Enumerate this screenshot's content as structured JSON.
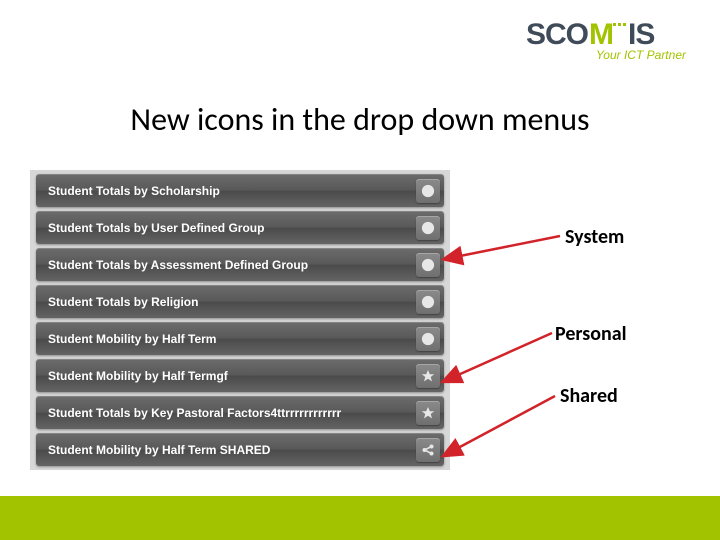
{
  "logo": {
    "word_prefix": "SCO",
    "word_accent": "M",
    "word_suffix": "IS",
    "tagline": "Your ICT Partner"
  },
  "title": "New icons in the drop down menus",
  "menu": [
    {
      "label": "Student Totals by Scholarship",
      "icon": "circle"
    },
    {
      "label": "Student Totals by User Defined Group",
      "icon": "circle"
    },
    {
      "label": "Student Totals by Assessment Defined Group",
      "icon": "circle"
    },
    {
      "label": "Student Totals by Religion",
      "icon": "circle"
    },
    {
      "label": "Student Mobility by Half Term",
      "icon": "circle"
    },
    {
      "label": "Student Mobility by Half Termgf",
      "icon": "star"
    },
    {
      "label": "Student Totals by Key Pastoral Factors4ttrrrrrrrrrrrr",
      "icon": "star"
    },
    {
      "label": "Student Mobility by Half Term SHARED",
      "icon": "share"
    }
  ],
  "annotations": {
    "system": "System",
    "personal": "Personal",
    "shared": "Shared"
  },
  "colors": {
    "accent": "#a2c300",
    "arrow": "#d2232a"
  }
}
